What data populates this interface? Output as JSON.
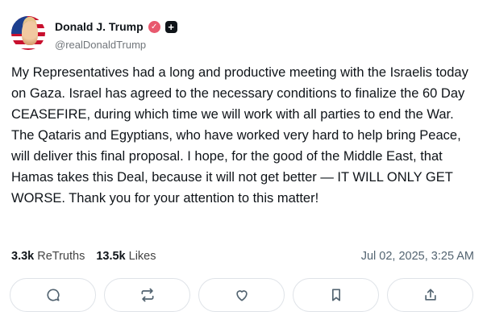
{
  "author": {
    "display_name": "Donald J. Trump",
    "handle": "@realDonaldTrump",
    "verified_icon": "verified-check-icon",
    "plus_icon": "plus-badge-icon"
  },
  "post": {
    "text": "My Representatives had a long and productive meeting with the Israelis today on Gaza. Israel has agreed to the necessary conditions to finalize the 60 Day CEASEFIRE, during which time we will work with all parties to end the War. The Qataris and Egyptians, who have worked very hard to help bring Peace, will deliver this final proposal. I hope, for the good of the Middle East, that Hamas takes this Deal, because it will not get better — IT WILL ONLY GET WORSE. Thank you for your attention to this matter!"
  },
  "stats": {
    "retruths_count": "3.3k",
    "retruths_label": "ReTruths",
    "likes_count": "13.5k",
    "likes_label": "Likes",
    "timestamp": "Jul 02, 2025, 3:25 AM"
  },
  "actions": [
    {
      "icon": "reply-icon"
    },
    {
      "icon": "retruth-icon"
    },
    {
      "icon": "like-icon"
    },
    {
      "icon": "bookmark-icon"
    },
    {
      "icon": "share-icon"
    }
  ],
  "colors": {
    "verified": "#e8596e",
    "text": "#0f1419",
    "muted": "#71767b",
    "border": "#dfe3e8"
  }
}
